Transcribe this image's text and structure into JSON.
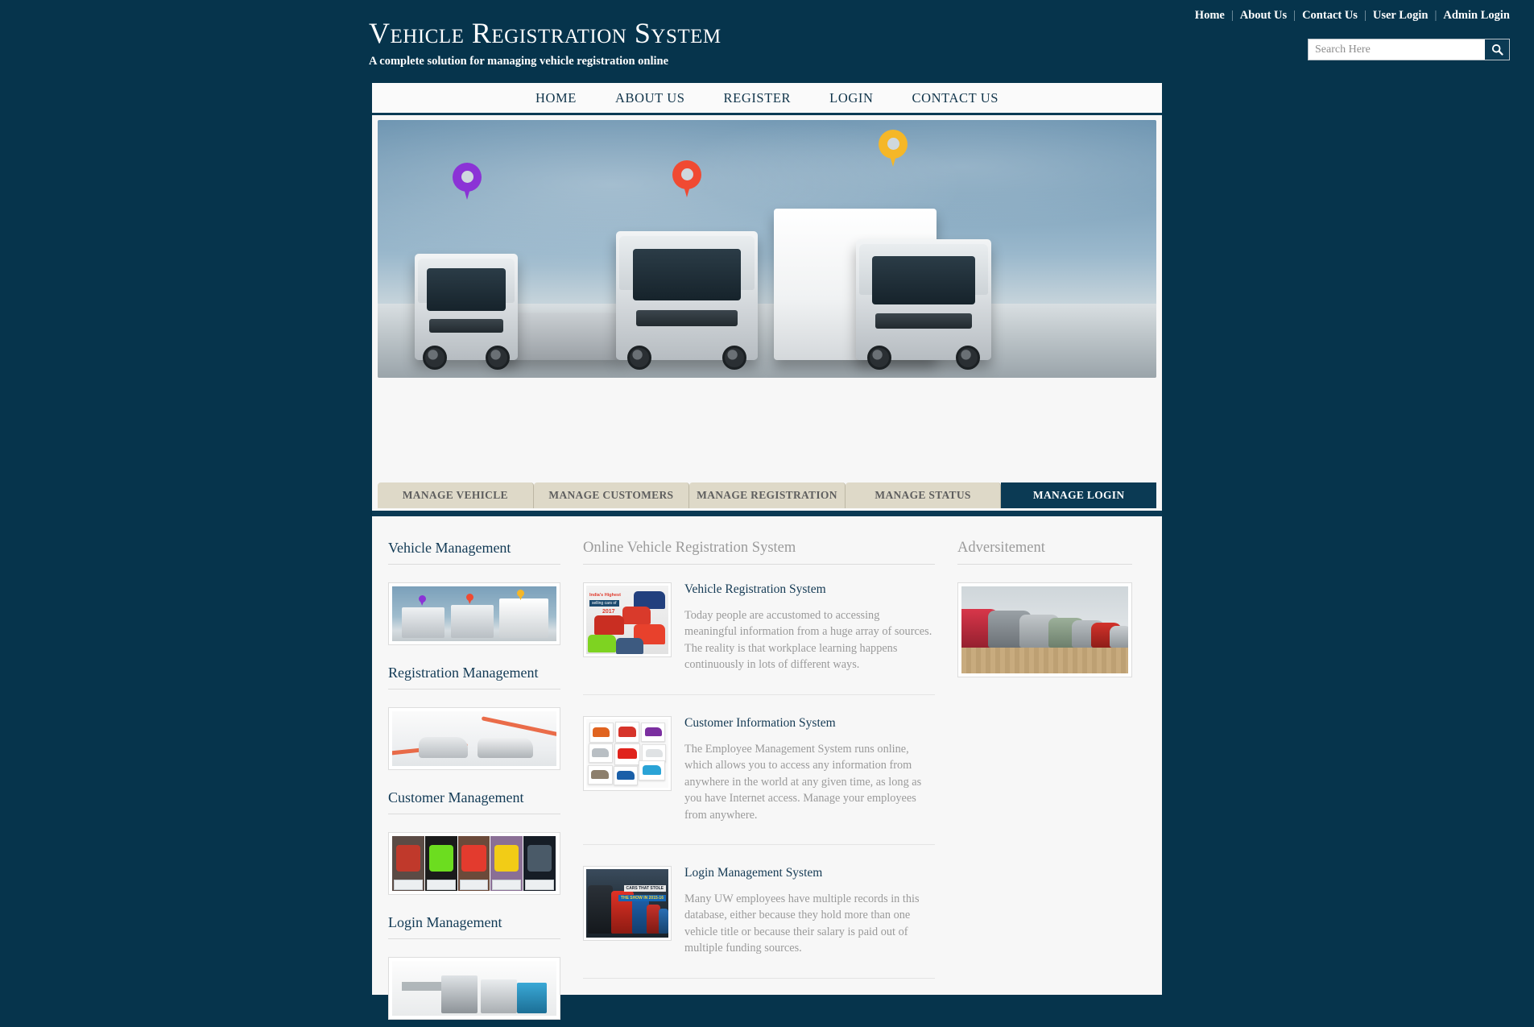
{
  "brand": {
    "title": "Vehicle Registration System",
    "subtitle": "A complete solution for managing vehicle registration online"
  },
  "colors": {
    "page_background": "#06344c",
    "panel_background": "#f7f7f7",
    "accent_navy": "#0b3a54",
    "tab_beige": "#ded9c8",
    "heading_navy": "#123a55",
    "muted_text": "#9a9a9a"
  },
  "top_links": [
    {
      "label": "Home"
    },
    {
      "label": "About Us"
    },
    {
      "label": "Contact Us"
    },
    {
      "label": "User Login"
    },
    {
      "label": "Admin Login"
    }
  ],
  "search": {
    "placeholder": "Search Here",
    "value": "",
    "icon": "search-icon"
  },
  "main_nav": [
    {
      "label": "HOME"
    },
    {
      "label": "ABOUT US"
    },
    {
      "label": "REGISTER"
    },
    {
      "label": "LOGIN"
    },
    {
      "label": "CONTACT US"
    }
  ],
  "hero": {
    "alt": "Three white delivery trucks with colored map pin markers above them",
    "pins": [
      {
        "name": "pin-purple",
        "color": "#8b33d6"
      },
      {
        "name": "pin-red",
        "color": "#f04a32"
      },
      {
        "name": "pin-yellow",
        "color": "#f5b728"
      }
    ]
  },
  "tabs": [
    {
      "label": "MANAGE VEHICLE",
      "active": false
    },
    {
      "label": "MANAGE CUSTOMERS",
      "active": false
    },
    {
      "label": "MANAGE REGISTRATION",
      "active": false
    },
    {
      "label": "MANAGE STATUS",
      "active": false
    },
    {
      "label": "MANAGE LOGIN",
      "active": true
    }
  ],
  "sidebar": {
    "sections": [
      {
        "title": "Vehicle Management",
        "image_alt": "Three trucks with map pins"
      },
      {
        "title": "Registration Management",
        "image_alt": "Two silver Audi cars on a curved road"
      },
      {
        "title": "Customer Management",
        "image_alt": "Five SUVs in red, green, red, yellow and grey with dealer badges"
      },
      {
        "title": "Login Management",
        "image_alt": "Logistics trucks and blue van over a world map"
      }
    ]
  },
  "main": {
    "heading": "Online Vehicle Registration System",
    "articles": [
      {
        "title": "Vehicle Registration System",
        "text": "Today people are accustomed to accessing meaningful information from a huge array of sources. The reality is that workplace learning happens continuously in lots of different ways.",
        "image_alt": "Collage poster: India's Highest selling cars of 2017",
        "image_text": {
          "line1": "India's Highest",
          "line2": "selling cars of",
          "year": "2017"
        }
      },
      {
        "title": "Customer Information System",
        "text": "The Employee Management System runs online, which allows you to access any information from anywhere in the world at any given time, as long as you have Internet access. Manage your employees from anywhere.",
        "image_alt": "Grid collage of small hatchback cars in many colors"
      },
      {
        "title": "Login Management System",
        "text": "Many UW employees have multiple records in this database, either because they hold more than one vehicle title or because their salary is paid out of multiple funding sources.",
        "image_alt": "Row of parked cars at night with banner text",
        "image_text": {
          "line1": "CARS THAT STOLE",
          "line2": "THE SHOW IN 2015-16"
        }
      }
    ]
  },
  "advertisement": {
    "heading": "Adversitement",
    "image_alt": "Row of parked cars on brick pavement"
  }
}
